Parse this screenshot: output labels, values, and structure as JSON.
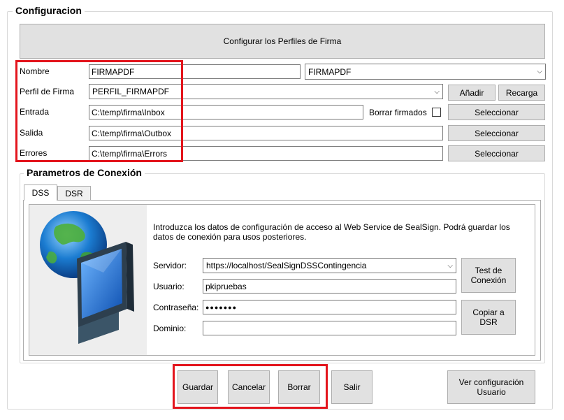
{
  "config": {
    "title": "Configuracion",
    "profiles_button": "Configurar los Perfiles de Firma",
    "nombre_label": "Nombre",
    "nombre_value": "FIRMAPDF",
    "nombre_combo_value": "FIRMAPDF",
    "perfil_label": "Perfil de Firma",
    "perfil_value": "PERFIL_FIRMAPDF",
    "anadir_button": "Añadir",
    "recarga_button": "Recarga",
    "entrada_label": "Entrada",
    "entrada_value": "C:\\temp\\firma\\Inbox",
    "borrar_firmados_label": "Borrar firmados",
    "salida_label": "Salida",
    "salida_value": "C:\\temp\\firma\\Outbox",
    "errores_label": "Errores",
    "errores_value": "C:\\temp\\firma\\Errors",
    "seleccionar_button": "Seleccionar"
  },
  "connection": {
    "title": "Parametros de Conexión",
    "tabs": [
      {
        "label": "DSS"
      },
      {
        "label": "DSR"
      }
    ],
    "intro": "Introduzca los datos de configuración de acceso al Web Service de SealSign. Podrá guardar los datos de conexión para usos posteriores.",
    "servidor_label": "Servidor:",
    "servidor_value": "https://localhost/SealSignDSSContingencia",
    "usuario_label": "Usuario:",
    "usuario_value": "pkipruebas",
    "contrasena_label": "Contraseña:",
    "contrasena_value": "●●●●●●●",
    "dominio_label": "Dominio:",
    "dominio_value": "",
    "test_button": "Test de Conexión",
    "copy_button": "Copiar a DSR"
  },
  "footer": {
    "guardar": "Guardar",
    "cancelar": "Cancelar",
    "borrar": "Borrar",
    "salir": "Salir",
    "ver_config": "Ver configuración Usuario"
  },
  "colors": {
    "highlight": "#e3141c",
    "button_bg": "#e1e1e1"
  }
}
